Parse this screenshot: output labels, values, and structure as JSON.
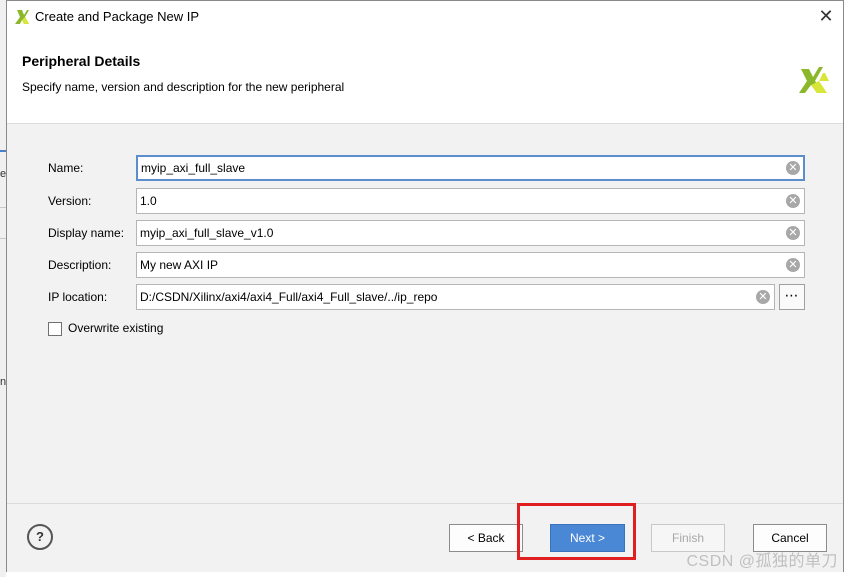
{
  "window": {
    "title": "Create and Package New IP",
    "close_icon": "close-icon",
    "logo_icon": "xilinx-logo-icon"
  },
  "header": {
    "title": "Peripheral Details",
    "subtitle": "Specify name, version and description for the new peripheral"
  },
  "form": {
    "name": {
      "label": "Name:",
      "value": "myip_axi_full_slave"
    },
    "version": {
      "label": "Version:",
      "value": "1.0"
    },
    "display_name": {
      "label": "Display name:",
      "value": "myip_axi_full_slave_v1.0"
    },
    "description": {
      "label": "Description:",
      "value": "My new AXI IP"
    },
    "ip_location": {
      "label": "IP location:",
      "value": "D:/CSDN/Xilinx/axi4/axi4_Full/axi4_Full_slave/../ip_repo",
      "browse_label": "⋯"
    },
    "overwrite": {
      "label": "Overwrite existing",
      "checked": false
    }
  },
  "footer": {
    "help_label": "?",
    "back_label": "< Back",
    "next_label": "Next >",
    "finish_label": "Finish",
    "cancel_label": "Cancel"
  },
  "background": {
    "glyph1": "e",
    "glyph2": "n"
  },
  "watermark": "CSDN @孤独的单刀",
  "colors": {
    "accent": "#4a88d5",
    "highlight": "#e02020",
    "logo_green": "#8bb82a",
    "logo_yellow": "#d8e63a"
  }
}
